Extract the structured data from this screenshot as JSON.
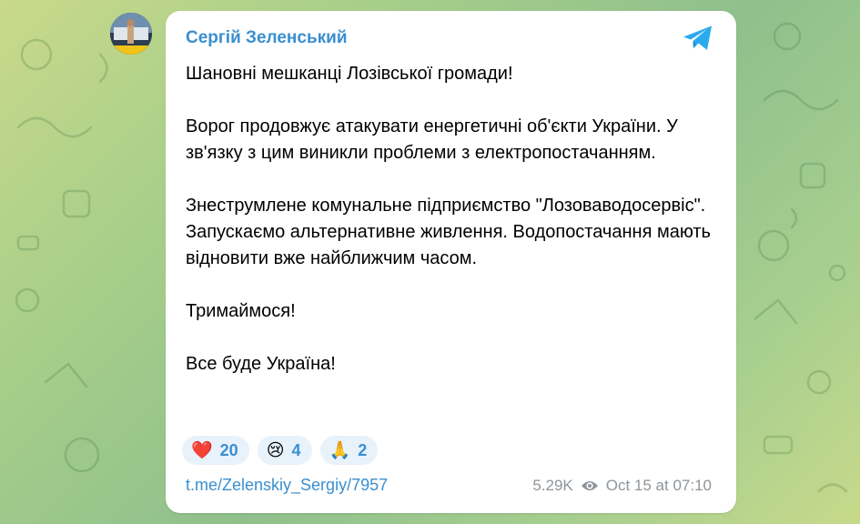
{
  "post": {
    "author": "Сергій Зеленський",
    "paragraphs": [
      "Шановні мешканці Лозівської громади!",
      "Ворог продовжує атакувати енергетичні об'єкти України. У зв'язку з цим виникли проблеми з електропостачанням.",
      "Знеструмлене комунальне підприємство \"Лозоваводосервіс\". Запускаємо альтернативне живлення. Водопостачання мають відновити вже найближчим часом.",
      "Тримаймося!",
      "Все буде Україна!"
    ],
    "reactions": [
      {
        "emoji": "❤️",
        "count": "20",
        "icon": "heart-icon"
      },
      {
        "emoji": "😢",
        "count": "4",
        "icon": "crying-face-icon"
      },
      {
        "emoji": "🙏",
        "count": "2",
        "icon": "praying-hands-icon"
      }
    ],
    "link": "t.me/Zelenskiy_Sergiy/7957",
    "views": "5.29K",
    "timestamp": "Oct 15 at 07:10"
  },
  "icons": {
    "telegram": "telegram-logo-icon",
    "views": "eye-icon",
    "avatar": "avatar"
  },
  "colors": {
    "accent": "#3a8fd0",
    "reaction_bg": "#e8f2fb",
    "meta_text": "#8e959b",
    "telegram_blue": "#2aabee"
  }
}
